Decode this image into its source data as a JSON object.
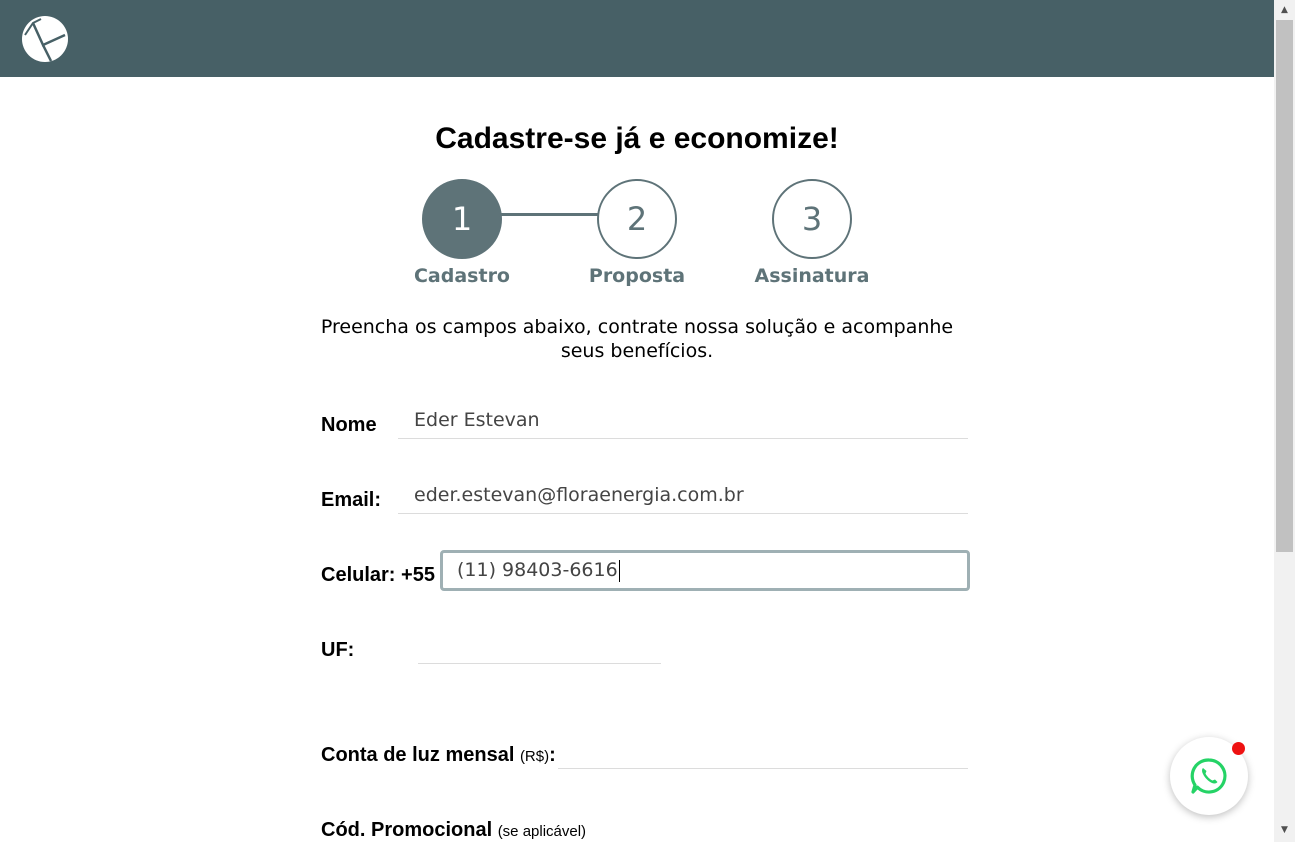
{
  "header": {
    "logo": "flora-leaf-logo"
  },
  "title": "Cadastre-se já e economize!",
  "steps": [
    {
      "number": "1",
      "label": "Cadastro",
      "active": true
    },
    {
      "number": "2",
      "label": "Proposta",
      "active": false
    },
    {
      "number": "3",
      "label": "Assinatura",
      "active": false
    }
  ],
  "intro": "Preencha os campos abaixo, contrate nossa solução e acompanhe seus benefícios.",
  "form": {
    "nome": {
      "label": "Nome",
      "value": "Eder Estevan"
    },
    "email": {
      "label": "Email:",
      "value": "eder.estevan@floraenergia.com.br"
    },
    "celular": {
      "label": "Celular: +55",
      "value": "(11) 98403-6616"
    },
    "uf": {
      "label": "UF:",
      "value": ""
    },
    "conta": {
      "label": "Conta de luz mensal",
      "hint": "(R$)",
      "suffix": ":",
      "value": ""
    },
    "promo": {
      "label": "Cód. Promocional",
      "hint": "(se aplicável)"
    }
  },
  "whatsapp": {
    "icon": "whatsapp-icon",
    "notification": true
  },
  "colors": {
    "header": "#476066",
    "accent": "#5e7378",
    "whatsapp": "#25d366",
    "badge": "#ee1111"
  }
}
